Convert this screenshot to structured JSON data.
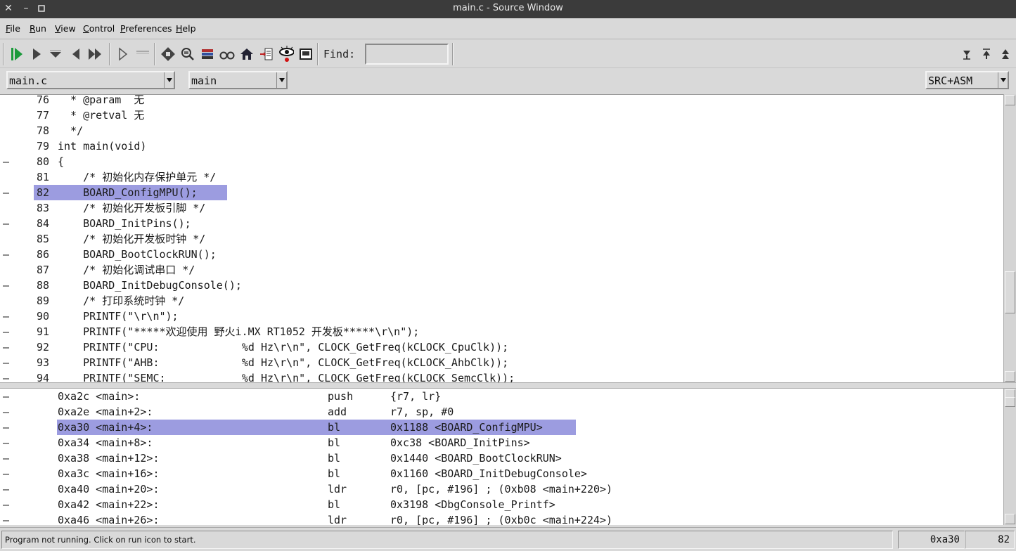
{
  "window": {
    "title": "main.c - Source Window"
  },
  "menu": {
    "file": {
      "u": "F",
      "rest": "ile"
    },
    "run": {
      "u": "R",
      "rest": "un"
    },
    "view": {
      "u": "V",
      "rest": "iew"
    },
    "control": {
      "u": "C",
      "rest": "ontrol"
    },
    "preferences": {
      "u": "P",
      "rest": "references"
    },
    "help": {
      "u": "H",
      "rest": "elp"
    }
  },
  "toolbar": {
    "find_label": "Find:",
    "find_value": "",
    "icons": [
      "run-icon",
      "continue-icon",
      "step-icon",
      "next-icon",
      "finish-icon",
      "step-asm-icon",
      "next-asm-icon",
      "registers-icon",
      "memory-icon",
      "stack-icon",
      "watch-icon",
      "locals-icon",
      "breakpoints-icon",
      "console-icon",
      "eye-icon",
      "function-browser-icon",
      "prev-hit-icon",
      "next-hit-icon",
      "top-icon"
    ]
  },
  "combos": {
    "file": "main.c",
    "function": "main",
    "mode": "SRC+ASM"
  },
  "source": {
    "lines": [
      {
        "bp": "",
        "ln": "76",
        "code": "  * @param  无"
      },
      {
        "bp": "",
        "ln": "77",
        "code": "  * @retval 无"
      },
      {
        "bp": "",
        "ln": "78",
        "code": "  */"
      },
      {
        "bp": "",
        "ln": "79",
        "code": "int main(void)"
      },
      {
        "bp": "–",
        "ln": "80",
        "code": "{"
      },
      {
        "bp": "",
        "ln": "81",
        "code": "    /* 初始化内存保护单元 */"
      },
      {
        "bp": "–",
        "ln": "82",
        "code": "    BOARD_ConfigMPU();"
      },
      {
        "bp": "",
        "ln": "83",
        "code": "    /* 初始化开发板引脚 */"
      },
      {
        "bp": "–",
        "ln": "84",
        "code": "    BOARD_InitPins();"
      },
      {
        "bp": "",
        "ln": "85",
        "code": "    /* 初始化开发板时钟 */"
      },
      {
        "bp": "–",
        "ln": "86",
        "code": "    BOARD_BootClockRUN();"
      },
      {
        "bp": "",
        "ln": "87",
        "code": "    /* 初始化调试串口 */"
      },
      {
        "bp": "–",
        "ln": "88",
        "code": "    BOARD_InitDebugConsole();"
      },
      {
        "bp": "",
        "ln": "89",
        "code": "    /* 打印系统时钟 */"
      },
      {
        "bp": "–",
        "ln": "90",
        "code": "    PRINTF(\"\\r\\n\");"
      },
      {
        "bp": "–",
        "ln": "91",
        "code": "    PRINTF(\"*****欢迎使用 野火i.MX RT1052 开发板*****\\r\\n\");"
      },
      {
        "bp": "–",
        "ln": "92",
        "code": "    PRINTF(\"CPU:             %d Hz\\r\\n\", CLOCK_GetFreq(kCLOCK_CpuClk));"
      },
      {
        "bp": "–",
        "ln": "93",
        "code": "    PRINTF(\"AHB:             %d Hz\\r\\n\", CLOCK_GetFreq(kCLOCK_AhbClk));"
      },
      {
        "bp": "–",
        "ln": "94",
        "code": "    PRINTF(\"SEMC:            %d Hz\\r\\n\", CLOCK_GetFreq(kCLOCK_SemcClk));"
      }
    ]
  },
  "asm": {
    "lines": [
      {
        "bp": "–",
        "addr": "0xa2c <main>:",
        "op": "push",
        "arg": "{r7, lr}"
      },
      {
        "bp": "–",
        "addr": "0xa2e <main+2>:",
        "op": "add",
        "arg": "r7, sp, #0"
      },
      {
        "bp": "–",
        "addr": "0xa30 <main+4>:",
        "op": "bl",
        "arg": "0x1188 <BOARD_ConfigMPU>"
      },
      {
        "bp": "–",
        "addr": "0xa34 <main+8>:",
        "op": "bl",
        "arg": "0xc38 <BOARD_InitPins>"
      },
      {
        "bp": "–",
        "addr": "0xa38 <main+12>:",
        "op": "bl",
        "arg": "0x1440 <BOARD_BootClockRUN>"
      },
      {
        "bp": "–",
        "addr": "0xa3c <main+16>:",
        "op": "bl",
        "arg": "0x1160 <BOARD_InitDebugConsole>"
      },
      {
        "bp": "–",
        "addr": "0xa40 <main+20>:",
        "op": "ldr",
        "arg": "r0, [pc, #196] ; (0xb08 <main+220>)"
      },
      {
        "bp": "–",
        "addr": "0xa42 <main+22>:",
        "op": "bl",
        "arg": "0x3198 <DbgConsole_Printf>"
      },
      {
        "bp": "–",
        "addr": "0xa46 <main+26>:",
        "op": "ldr",
        "arg": "r0, [pc, #196] ; (0xb0c <main+224>)"
      }
    ]
  },
  "status": {
    "message": "Program not running. Click on run icon to start.",
    "address": "0xa30",
    "line": "82"
  },
  "colors": {
    "highlight": "#9c9ce0",
    "titlebar": "#3b3b3b",
    "chrome": "#d9d9d9"
  }
}
